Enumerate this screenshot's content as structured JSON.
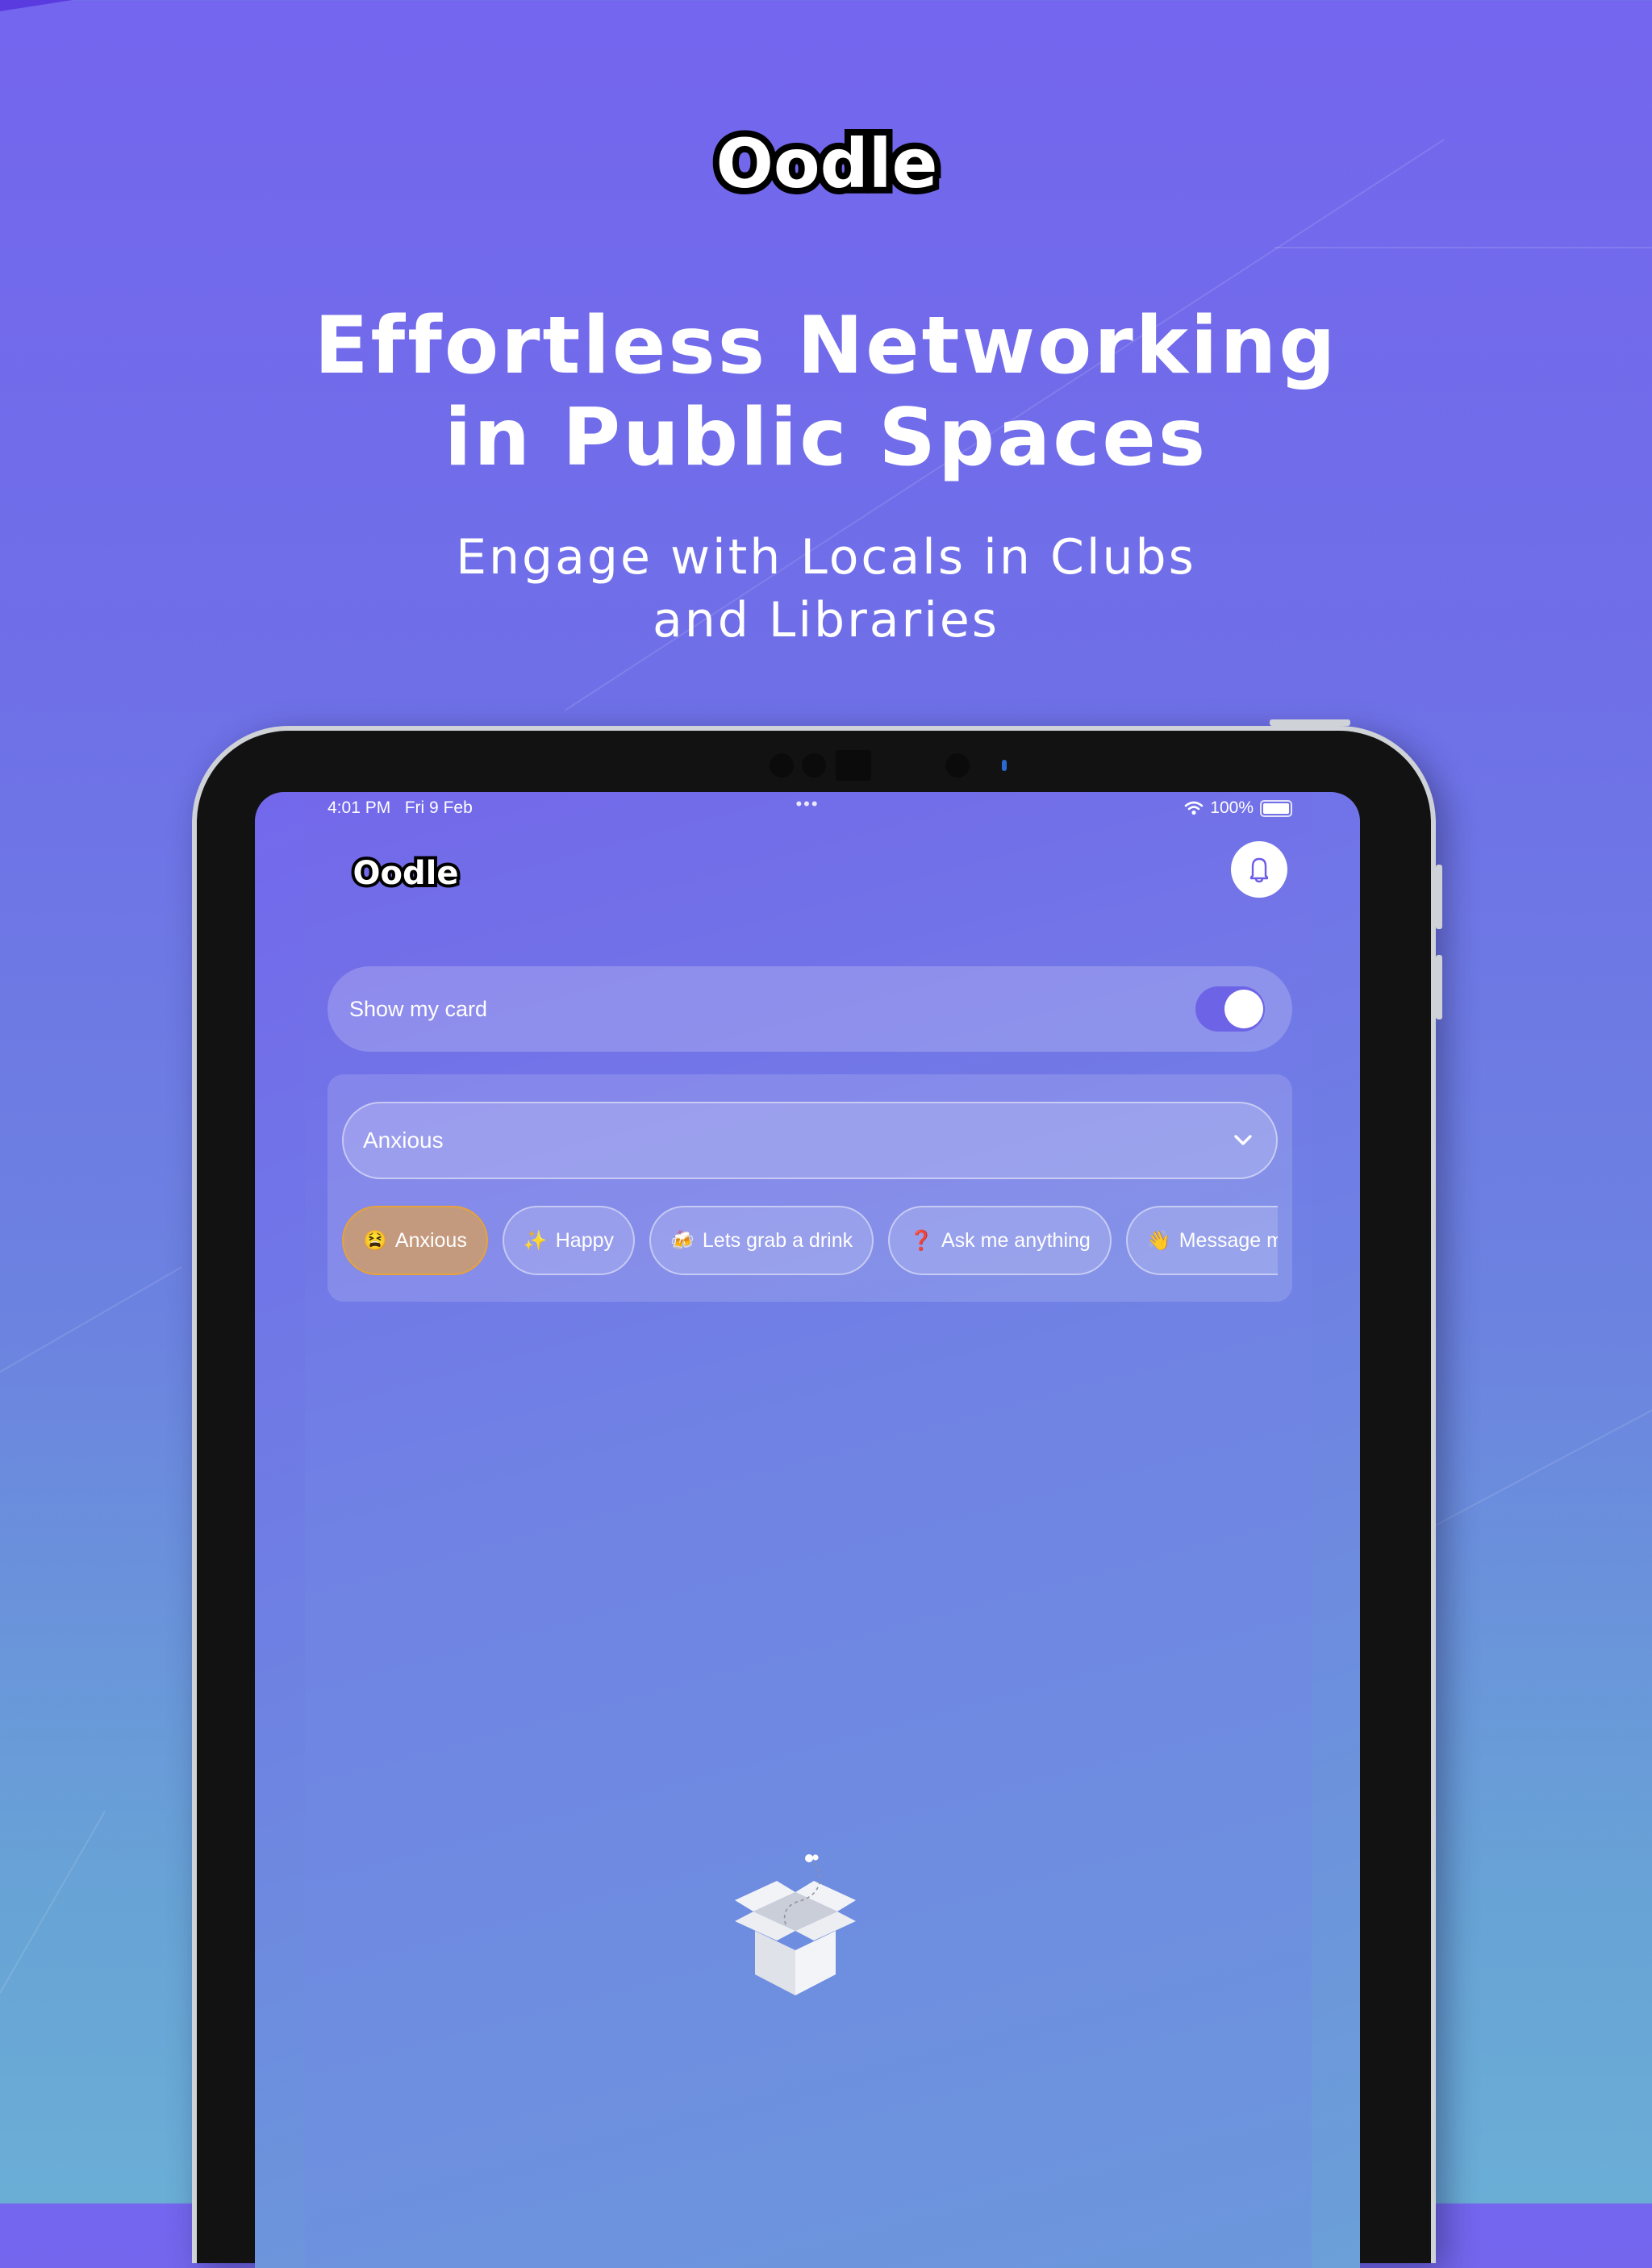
{
  "brand": {
    "name": "Oodle"
  },
  "hero": {
    "title_line1": "Effortless Networking",
    "title_line2": "in Public Spaces",
    "subtitle_line1": "Engage with Locals in Clubs",
    "subtitle_line2": "and Libraries"
  },
  "device": {
    "status_bar": {
      "time": "4:01 PM",
      "date": "Fri 9 Feb",
      "multitask_indicator": "•••",
      "battery": "100%"
    },
    "app": {
      "logo": "Oodle",
      "notification_icon": "bell-icon",
      "show_card": {
        "label": "Show my card",
        "enabled": true
      },
      "mood": {
        "selected": "Anxious",
        "options": [
          {
            "emoji": "😫",
            "label": "Anxious",
            "selected": true
          },
          {
            "emoji": "✨",
            "label": "Happy",
            "selected": false
          },
          {
            "emoji": "🍻",
            "label": "Lets grab a drink",
            "selected": false
          },
          {
            "emoji": "❓",
            "label": "Ask me anything",
            "selected": false
          },
          {
            "emoji": "👋",
            "label": "Message me",
            "selected": false
          }
        ]
      },
      "empty_state_icon": "open-box-icon"
    }
  },
  "colors": {
    "background_top": "#7466ee",
    "background_bottom": "#6aaed6",
    "toggle_on": "#6c63e6",
    "chip_selected_fill": "#c49a7e",
    "chip_selected_border": "#e6a23c",
    "bell_icon": "#6c5ce7"
  }
}
